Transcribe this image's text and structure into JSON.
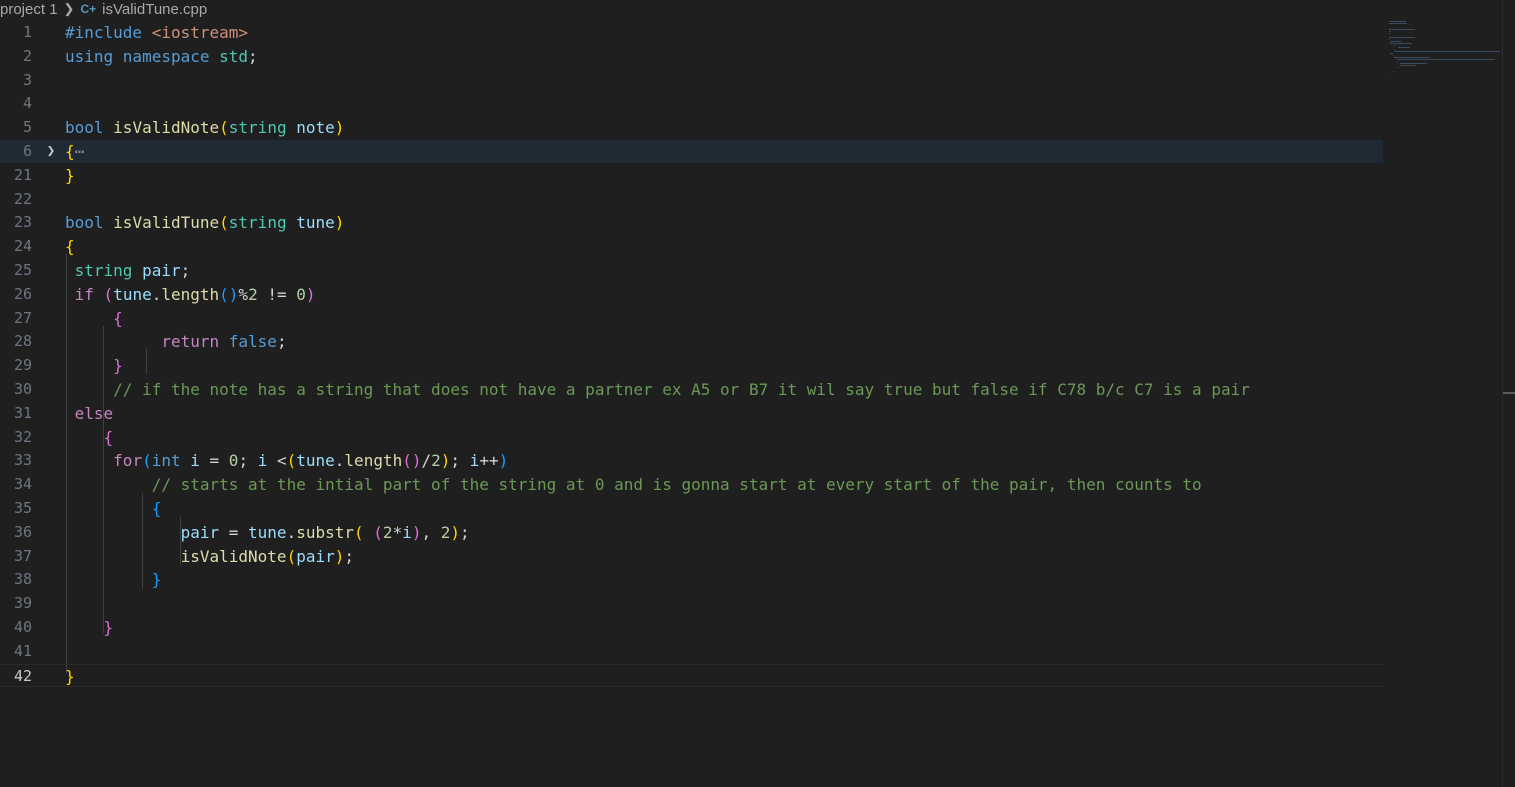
{
  "breadcrumb": {
    "folder": "project 1",
    "separator": ">",
    "file_icon": "C+",
    "file": "isValidTune.cpp"
  },
  "editor": {
    "current_line": "42",
    "folded_line": "6",
    "lines": [
      {
        "n": "1",
        "tokens": [
          [
            "kw",
            "#include "
          ],
          [
            "str",
            "<iostream>"
          ]
        ]
      },
      {
        "n": "2",
        "tokens": [
          [
            "kw",
            "using "
          ],
          [
            "kw",
            "namespace "
          ],
          [
            "type",
            "std"
          ],
          [
            "txt",
            ";"
          ]
        ]
      },
      {
        "n": "3",
        "tokens": []
      },
      {
        "n": "4",
        "tokens": []
      },
      {
        "n": "5",
        "tokens": [
          [
            "kw",
            "bool "
          ],
          [
            "fn",
            "isValidNote"
          ],
          [
            "b1",
            "("
          ],
          [
            "type",
            "string "
          ],
          [
            "var",
            "note"
          ],
          [
            "b1",
            ")"
          ]
        ]
      },
      {
        "n": "6",
        "fold": true,
        "tokens": [
          [
            "b1",
            "{"
          ],
          [
            "ell",
            "⋯"
          ]
        ]
      },
      {
        "n": "21",
        "tokens": [
          [
            "b1",
            "}"
          ]
        ]
      },
      {
        "n": "22",
        "tokens": []
      },
      {
        "n": "23",
        "tokens": [
          [
            "kw",
            "bool "
          ],
          [
            "fn",
            "isValidTune"
          ],
          [
            "b1",
            "("
          ],
          [
            "type",
            "string "
          ],
          [
            "var",
            "tune"
          ],
          [
            "b1",
            ")"
          ]
        ]
      },
      {
        "n": "24",
        "tokens": [
          [
            "b1",
            "{"
          ]
        ]
      },
      {
        "n": "25",
        "tokens": [
          [
            "txt",
            " "
          ],
          [
            "type",
            "string "
          ],
          [
            "var",
            "pair"
          ],
          [
            "txt",
            ";"
          ]
        ]
      },
      {
        "n": "26",
        "tokens": [
          [
            "txt",
            " "
          ],
          [
            "ctl",
            "if "
          ],
          [
            "b2",
            "("
          ],
          [
            "var",
            "tune"
          ],
          [
            "txt",
            "."
          ],
          [
            "fn",
            "length"
          ],
          [
            "b3",
            "()"
          ],
          [
            "txt",
            "%"
          ],
          [
            "num",
            "2"
          ],
          [
            "txt",
            " != "
          ],
          [
            "num",
            "0"
          ],
          [
            "b2",
            ")"
          ]
        ]
      },
      {
        "n": "27",
        "tokens": [
          [
            "txt",
            "     "
          ],
          [
            "b2",
            "{"
          ]
        ]
      },
      {
        "n": "28",
        "tokens": [
          [
            "txt",
            "          "
          ],
          [
            "ctl",
            "return "
          ],
          [
            "kw",
            "false"
          ],
          [
            "txt",
            ";"
          ]
        ]
      },
      {
        "n": "29",
        "tokens": [
          [
            "txt",
            "     "
          ],
          [
            "b2",
            "}"
          ]
        ]
      },
      {
        "n": "30",
        "tokens": [
          [
            "txt",
            "     "
          ],
          [
            "com",
            "// if the note has a string that does not have a partner ex A5 or B7 it wil say true but false if C78 b/c C7 is a pair"
          ]
        ]
      },
      {
        "n": "31",
        "tokens": [
          [
            "txt",
            " "
          ],
          [
            "ctl",
            "else"
          ]
        ]
      },
      {
        "n": "32",
        "tokens": [
          [
            "txt",
            "    "
          ],
          [
            "b2",
            "{"
          ]
        ]
      },
      {
        "n": "33",
        "tokens": [
          [
            "txt",
            "     "
          ],
          [
            "ctl",
            "for"
          ],
          [
            "b3",
            "("
          ],
          [
            "kw",
            "int "
          ],
          [
            "var",
            "i"
          ],
          [
            "txt",
            " = "
          ],
          [
            "num",
            "0"
          ],
          [
            "txt",
            "; "
          ],
          [
            "var",
            "i"
          ],
          [
            "txt",
            " <"
          ],
          [
            "b1",
            "("
          ],
          [
            "var",
            "tune"
          ],
          [
            "txt",
            "."
          ],
          [
            "fn",
            "length"
          ],
          [
            "b2",
            "()"
          ],
          [
            "txt",
            "/"
          ],
          [
            "num",
            "2"
          ],
          [
            "b1",
            ")"
          ],
          [
            "txt",
            "; "
          ],
          [
            "var",
            "i"
          ],
          [
            "txt",
            "++"
          ],
          [
            "b3",
            ")"
          ]
        ]
      },
      {
        "n": "34",
        "tokens": [
          [
            "txt",
            "         "
          ],
          [
            "com",
            "// starts at the intial part of the string at 0 and is gonna start at every start of the pair, then counts to"
          ]
        ]
      },
      {
        "n": "35",
        "tokens": [
          [
            "txt",
            "         "
          ],
          [
            "b3",
            "{"
          ]
        ]
      },
      {
        "n": "36",
        "tokens": [
          [
            "txt",
            "            "
          ],
          [
            "var",
            "pair"
          ],
          [
            "txt",
            " = "
          ],
          [
            "var",
            "tune"
          ],
          [
            "txt",
            "."
          ],
          [
            "fn",
            "substr"
          ],
          [
            "b1",
            "("
          ],
          [
            "txt",
            " "
          ],
          [
            "b2",
            "("
          ],
          [
            "num",
            "2"
          ],
          [
            "txt",
            "*"
          ],
          [
            "var",
            "i"
          ],
          [
            "b2",
            ")"
          ],
          [
            "txt",
            ", "
          ],
          [
            "num",
            "2"
          ],
          [
            "b1",
            ")"
          ],
          [
            "txt",
            ";"
          ]
        ]
      },
      {
        "n": "37",
        "tokens": [
          [
            "txt",
            "            "
          ],
          [
            "fn",
            "isValidNote"
          ],
          [
            "b1",
            "("
          ],
          [
            "var",
            "pair"
          ],
          [
            "b1",
            ")"
          ],
          [
            "txt",
            ";"
          ]
        ]
      },
      {
        "n": "38",
        "tokens": [
          [
            "txt",
            "         "
          ],
          [
            "b3",
            "}"
          ]
        ]
      },
      {
        "n": "39",
        "tokens": []
      },
      {
        "n": "40",
        "tokens": [
          [
            "txt",
            "    "
          ],
          [
            "b2",
            "}"
          ]
        ]
      },
      {
        "n": "41",
        "tokens": []
      },
      {
        "n": "42",
        "tokens": [
          [
            "b1",
            "}"
          ]
        ]
      }
    ]
  },
  "icons": {
    "fold": "chevron-right-icon",
    "file": "cpp-file-icon"
  }
}
